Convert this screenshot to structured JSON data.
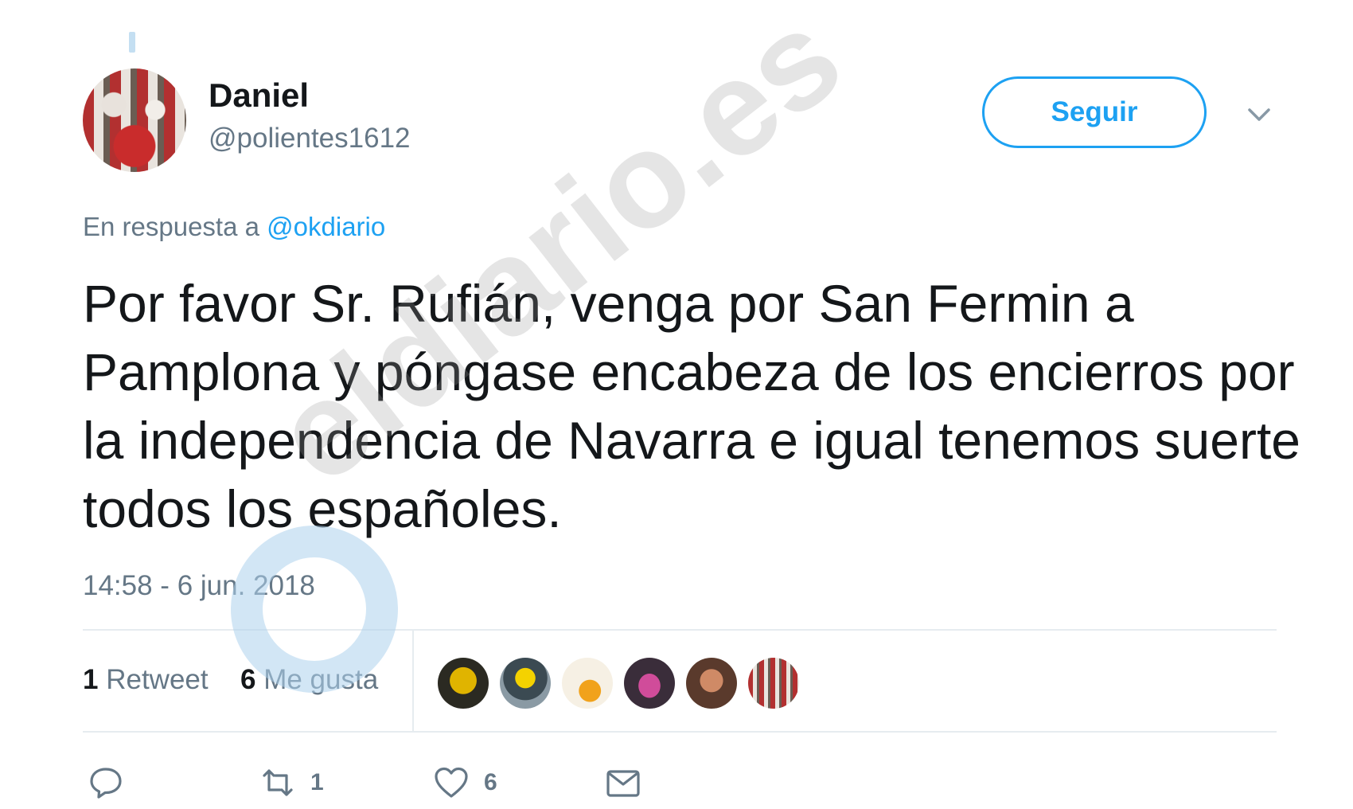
{
  "author": {
    "name": "Daniel",
    "handle": "@polientes1612"
  },
  "follow_button": {
    "label": "Seguir"
  },
  "icons": {
    "menu": "chevron-down-icon",
    "reply": "reply-icon",
    "retweet": "retweet-icon",
    "like": "heart-icon",
    "dm": "envelope-icon"
  },
  "reply_context": {
    "prefix": "En respuesta a",
    "mention": "@okdiario"
  },
  "tweet": {
    "text": "Por favor Sr. Rufián, venga por San Fermin a Pamplona y póngase encabeza de los encierros por la independencia de Navarra e igual tenemos suerte todos los españoles.",
    "timestamp": "14:58 - 6 jun. 2018"
  },
  "stats": {
    "retweet_count": "1",
    "retweet_label": "Retweet",
    "like_count": "6",
    "like_label": "Me gusta"
  },
  "actions": {
    "retweet_count": "1",
    "like_count": "6"
  },
  "watermark": {
    "text": "eldiario.es"
  },
  "colors": {
    "accent": "#1da1f2",
    "text": "#14171a",
    "muted": "#657786",
    "divider": "#e6ecf0"
  }
}
